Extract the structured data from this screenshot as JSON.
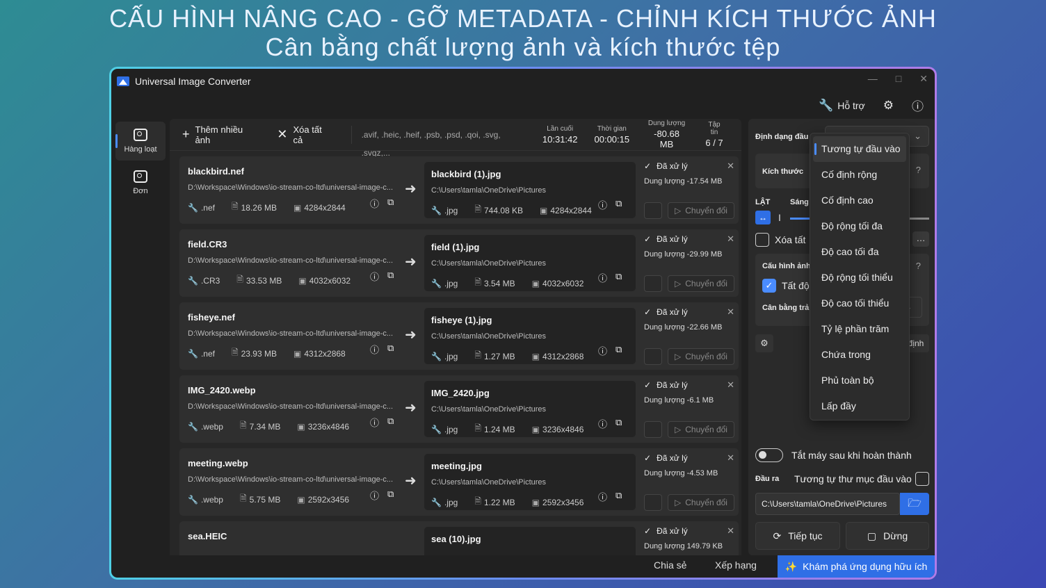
{
  "banner": {
    "line1": "CẤU HÌNH NÂNG CAO - GỠ METADATA - CHỈNH KÍCH THƯỚC ẢNH",
    "line2": "Cân bằng chất lượng ảnh và kích thước tệp"
  },
  "window": {
    "title": "Universal Image Converter"
  },
  "header": {
    "support_label": "Hỗ trợ"
  },
  "nav": {
    "batch": "Hàng loạt",
    "single": "Đơn"
  },
  "toolbar": {
    "add_label": "Thêm nhiều ảnh",
    "clear_label": "Xóa tất cả",
    "formats": ".avif, .heic, .heif, .psb, .psd, .qoi, .svg, .svgz,...",
    "stats": [
      {
        "label": "Lần cuối",
        "value": "10:31:42"
      },
      {
        "label": "Thời gian",
        "value": "00:00:15"
      },
      {
        "label": "Dung lượng",
        "value": "-80.68 MB"
      },
      {
        "label": "Tập tin",
        "value": "6 / 7"
      }
    ]
  },
  "status_done": "Đã xử lý",
  "convert_label": "Chuyển đổi",
  "rows": [
    {
      "src_name": "blackbird.nef",
      "src_path": "D:\\Workspace\\Windows\\io-stream-co-ltd\\universal-image-c...",
      "src_ext": ".nef",
      "src_size": "18.26 MB",
      "src_dim": "4284x2844",
      "dst_name": "blackbird (1).jpg",
      "dst_path": "C:\\Users\\tamla\\OneDrive\\Pictures",
      "dst_ext": ".jpg",
      "dst_size": "744.08 KB",
      "dst_dim": "4284x2844",
      "delta": "Dung lượng -17.54 MB"
    },
    {
      "src_name": "field.CR3",
      "src_path": "D:\\Workspace\\Windows\\io-stream-co-ltd\\universal-image-c...",
      "src_ext": ".CR3",
      "src_size": "33.53 MB",
      "src_dim": "4032x6032",
      "dst_name": "field (1).jpg",
      "dst_path": "C:\\Users\\tamla\\OneDrive\\Pictures",
      "dst_ext": ".jpg",
      "dst_size": "3.54 MB",
      "dst_dim": "4032x6032",
      "delta": "Dung lượng -29.99 MB"
    },
    {
      "src_name": "fisheye.nef",
      "src_path": "D:\\Workspace\\Windows\\io-stream-co-ltd\\universal-image-c...",
      "src_ext": ".nef",
      "src_size": "23.93 MB",
      "src_dim": "4312x2868",
      "dst_name": "fisheye (1).jpg",
      "dst_path": "C:\\Users\\tamla\\OneDrive\\Pictures",
      "dst_ext": ".jpg",
      "dst_size": "1.27 MB",
      "dst_dim": "4312x2868",
      "delta": "Dung lượng -22.66 MB"
    },
    {
      "src_name": "IMG_2420.webp",
      "src_path": "D:\\Workspace\\Windows\\io-stream-co-ltd\\universal-image-c...",
      "src_ext": ".webp",
      "src_size": "7.34 MB",
      "src_dim": "3236x4846",
      "dst_name": "IMG_2420.jpg",
      "dst_path": "C:\\Users\\tamla\\OneDrive\\Pictures",
      "dst_ext": ".jpg",
      "dst_size": "1.24 MB",
      "dst_dim": "3236x4846",
      "delta": "Dung lượng -6.1 MB"
    },
    {
      "src_name": "meeting.webp",
      "src_path": "D:\\Workspace\\Windows\\io-stream-co-ltd\\universal-image-c...",
      "src_ext": ".webp",
      "src_size": "5.75 MB",
      "src_dim": "2592x3456",
      "dst_name": "meeting.jpg",
      "dst_path": "C:\\Users\\tamla\\OneDrive\\Pictures",
      "dst_ext": ".jpg",
      "dst_size": "1.22 MB",
      "dst_dim": "2592x3456",
      "delta": "Dung lượng -4.53 MB"
    },
    {
      "src_name": "sea.HEIC",
      "src_path": "",
      "src_ext": "",
      "src_size": "",
      "src_dim": "",
      "dst_name": "sea (10).jpg",
      "dst_path": "",
      "dst_ext": "",
      "dst_size": "",
      "dst_dim": "",
      "delta": "Dung lượng 149.79 KB"
    }
  ],
  "panel": {
    "output_format_label": "Định dạng đầu",
    "size_label": "Kích thước",
    "flip_label": "LẬT",
    "brightness_label": "Sáng",
    "clear_label": "Xóa tất",
    "config_label": "Cấu hình ảnh",
    "auto_label": "Tất độ",
    "balance_label": "Cân bằng trả",
    "fixed_label": "định",
    "shutdown_label": "Tắt máy sau khi hoàn thành",
    "output_label": "Đầu ra",
    "same_folder_label": "Tương tự thư mục đầu vào",
    "output_path": "C:\\Users\\tamla\\OneDrive\\Pictures",
    "continue_label": "Tiếp tục",
    "stop_label": "Dừng"
  },
  "dropdown": {
    "items": [
      "Tương tự đầu vào",
      "Cố định rộng",
      "Cố định cao",
      "Độ rộng tối đa",
      "Độ cao tối đa",
      "Độ rộng tối thiểu",
      "Độ cao tối thiểu",
      "Tỷ lệ phần trăm",
      "Chứa trong",
      "Phủ toàn bộ",
      "Lấp đầy"
    ],
    "selected": "Tương tự đầu vào"
  },
  "bottom": {
    "share": "Chia sẻ",
    "rate": "Xếp hạng",
    "explore": "Khám phá ứng dụng hữu ích"
  },
  "colors": {
    "accent": "#2f6fe6"
  }
}
